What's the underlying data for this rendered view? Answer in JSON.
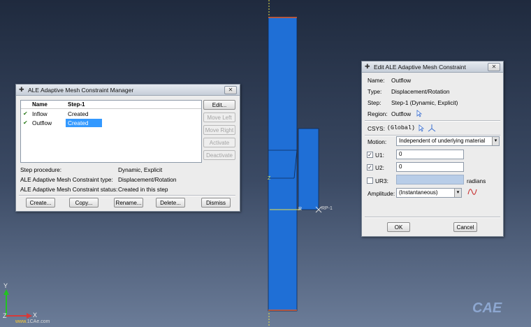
{
  "viewport": {
    "rp_label": "RP-1",
    "node_label": "R",
    "z_marker": "Z",
    "triad_labels": {
      "y": "Y",
      "x": "X",
      "z": "Z"
    },
    "watermark_url": "www.",
    "watermark_url2": "1CAe.com",
    "watermark_logo": "CAE"
  },
  "manager": {
    "title": "ALE Adaptive Mesh Constraint Manager",
    "close_label": "✕",
    "table": {
      "headers": [
        "Name",
        "Step-1"
      ],
      "rows": [
        {
          "check": "✔",
          "name": "Inflow",
          "status": "Created",
          "selected": false
        },
        {
          "check": "✔",
          "name": "Outflow",
          "status": "Created",
          "selected": true
        }
      ]
    },
    "side_buttons": {
      "edit": "Edit...",
      "move_left": "Move Left",
      "move_right": "Move Right",
      "activate": "Activate",
      "deactivate": "Deactivate"
    },
    "info": [
      {
        "label": "Step procedure:",
        "value": "Dynamic, Explicit"
      },
      {
        "label": "ALE Adaptive Mesh Constraint type:",
        "value": "Displacement/Rotation"
      },
      {
        "label": "ALE Adaptive Mesh Constraint status:",
        "value": "Created in this step"
      }
    ],
    "bottom_buttons": {
      "create": "Create...",
      "copy": "Copy...",
      "rename": "Rename...",
      "delete": "Delete...",
      "dismiss": "Dismiss"
    }
  },
  "editor": {
    "title": "Edit ALE Adaptive Mesh Constraint",
    "close_label": "✕",
    "name_label": "Name:",
    "name_value": "Outflow",
    "type_label": "Type:",
    "type_value": "Displacement/Rotation",
    "step_label": "Step:",
    "step_value": "Step-1 (Dynamic, Explicit)",
    "region_label": "Region:",
    "region_value": "Outflow",
    "csys_label": "CSYS:",
    "csys_value": "(Global)",
    "motion_label": "Motion:",
    "motion_value": "Independent of underlying material",
    "u1_label": "U1:",
    "u1_value": "0",
    "u2_label": "U2:",
    "u2_value": "0",
    "ur3_label": "UR3:",
    "ur3_value": "",
    "ur3_unit": "radians",
    "amplitude_label": "Amplitude:",
    "amplitude_value": "(Instantaneous)",
    "ok_label": "OK",
    "cancel_label": "Cancel",
    "u1_checked": true,
    "u2_checked": true,
    "ur3_checked": false
  },
  "colors": {
    "part_blue": "#1f6fd6",
    "axis_yellow": "#e8e24a",
    "selection_blue": "#3399ff"
  }
}
